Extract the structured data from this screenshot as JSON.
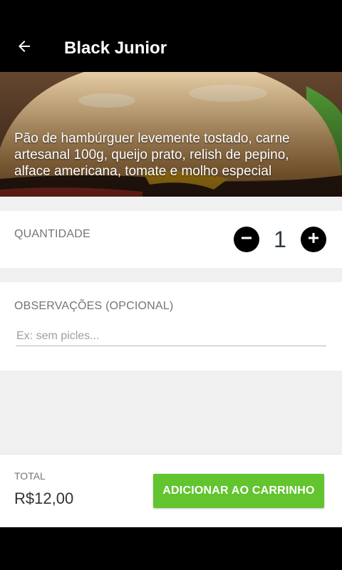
{
  "appbar": {
    "title": "Black Junior",
    "back_icon": "arrow-left-icon"
  },
  "hero": {
    "description": "Pão de hambúrguer levemente tostado, carne artesanal 100g, queijo prato, relish de pepino, alface americana, tomate e molho especial"
  },
  "quantity": {
    "label": "QUANTIDADE",
    "value": "1",
    "minus_icon": "minus-icon",
    "plus_icon": "plus-icon"
  },
  "notes": {
    "label": "OBSERVAÇÕES (OPCIONAL)",
    "placeholder": "Ex: sem picles...",
    "value": ""
  },
  "footer": {
    "total_label": "TOTAL",
    "total_value": "R$12,00",
    "add_button_label": "ADICIONAR AO CARRINHO"
  },
  "colors": {
    "accent": "#62c42f",
    "appbar": "#000000",
    "background": "#f0f0f0"
  }
}
